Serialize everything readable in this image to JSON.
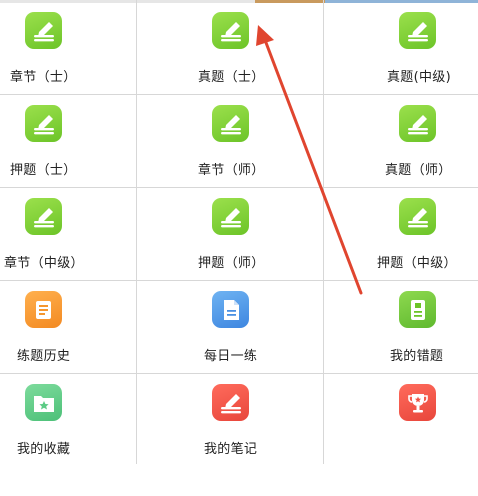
{
  "colors": {
    "green": "#79cc32",
    "orange": "#f5962e",
    "blue": "#4a90e2",
    "mint": "#5ccb85",
    "red": "#ef4f43",
    "annotation_arrow": "#e0452f"
  },
  "rows": [
    [
      {
        "label": "章节（士）",
        "icon": "pencil-icon"
      },
      {
        "label": "真题（士）",
        "icon": "pencil-icon"
      },
      {
        "label": "真题(中级)",
        "icon": "pencil-icon"
      }
    ],
    [
      {
        "label": "押题（士）",
        "icon": "pencil-icon"
      },
      {
        "label": "章节（师）",
        "icon": "pencil-icon"
      },
      {
        "label": "真题（师）",
        "icon": "pencil-icon"
      }
    ],
    [
      {
        "label": "章节（中级）",
        "icon": "pencil-icon"
      },
      {
        "label": "押题（师）",
        "icon": "pencil-icon"
      },
      {
        "label": "押题（中级）",
        "icon": "pencil-icon"
      }
    ],
    [
      {
        "label": "练题历史",
        "icon": "book-icon"
      },
      {
        "label": "每日一练",
        "icon": "document-icon"
      },
      {
        "label": "我的错题",
        "icon": "notebook-icon"
      }
    ],
    [
      {
        "label": "我的收藏",
        "icon": "star-folder-icon"
      },
      {
        "label": "我的笔记",
        "icon": "pencil-icon"
      },
      {
        "label": "",
        "icon": "trophy-icon"
      }
    ]
  ]
}
